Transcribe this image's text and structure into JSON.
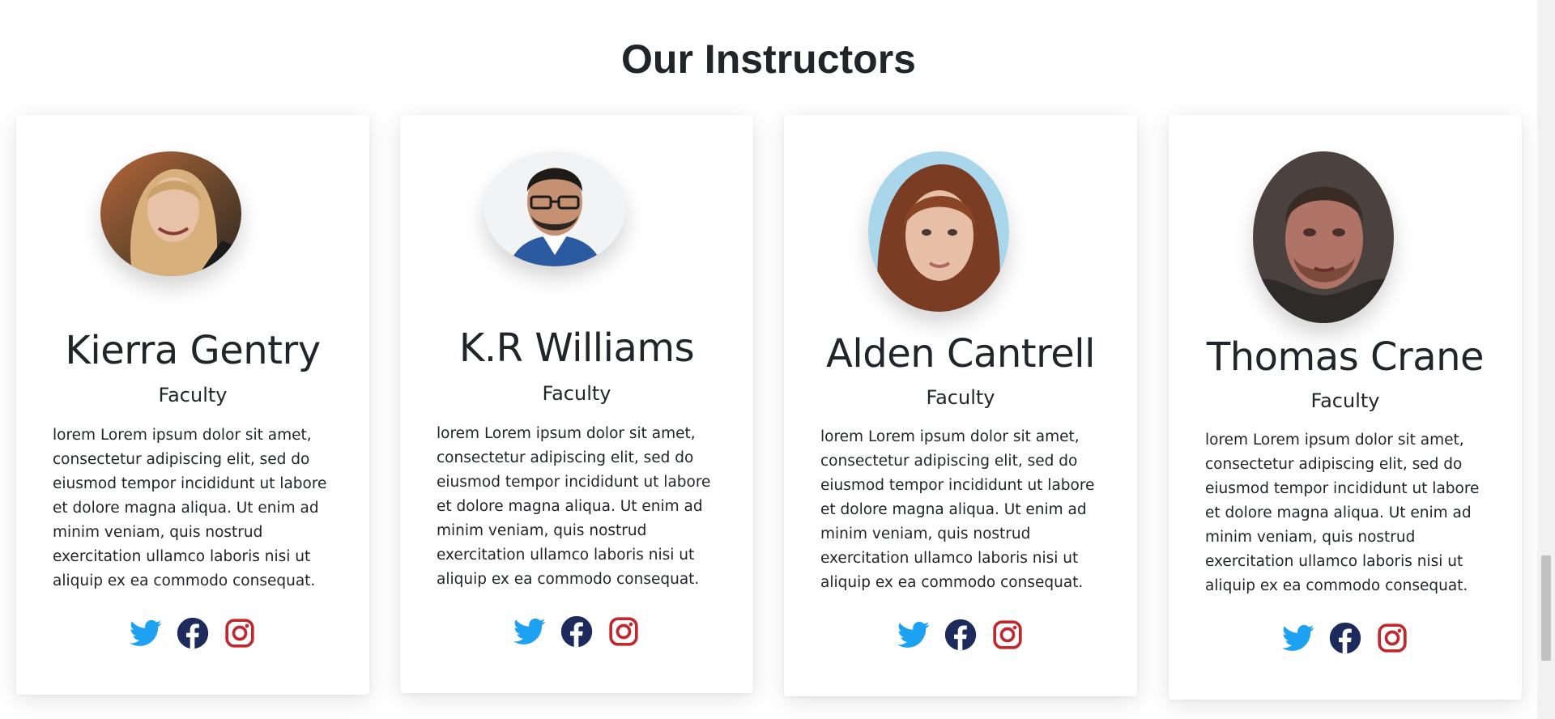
{
  "section": {
    "title": "Our Instructors"
  },
  "instructors": [
    {
      "name": "Kierra Gentry",
      "role": "Faculty",
      "bio": "lorem Lorem ipsum dolor sit amet, consectetur adipiscing elit, sed do eiusmod tempor incididunt ut labore et dolore magna aliqua. Ut enim ad minim veniam, quis nostrud exercitation ullamco laboris nisi ut aliquip ex ea commodo consequat.",
      "socials": [
        "twitter-icon",
        "facebook-icon",
        "instagram-icon"
      ]
    },
    {
      "name": "K.R Williams",
      "role": "Faculty",
      "bio": "lorem Lorem ipsum dolor sit amet, consectetur adipiscing elit, sed do eiusmod tempor incididunt ut labore et dolore magna aliqua. Ut enim ad minim veniam, quis nostrud exercitation ullamco laboris nisi ut aliquip ex ea commodo consequat.",
      "socials": [
        "twitter-icon",
        "facebook-icon",
        "instagram-icon"
      ]
    },
    {
      "name": "Alden Cantrell",
      "role": "Faculty",
      "bio": "lorem Lorem ipsum dolor sit amet, consectetur adipiscing elit, sed do eiusmod tempor incididunt ut labore et dolore magna aliqua. Ut enim ad minim veniam, quis nostrud exercitation ullamco laboris nisi ut aliquip ex ea commodo consequat.",
      "socials": [
        "twitter-icon",
        "facebook-icon",
        "instagram-icon"
      ]
    },
    {
      "name": "Thomas Crane",
      "role": "Faculty",
      "bio": "lorem Lorem ipsum dolor sit amet, consectetur adipiscing elit, sed do eiusmod tempor incididunt ut labore et dolore magna aliqua. Ut enim ad minim veniam, quis nostrud exercitation ullamco laboris nisi ut aliquip ex ea commodo consequat.",
      "socials": [
        "twitter-icon",
        "facebook-icon",
        "instagram-icon"
      ]
    }
  ],
  "colors": {
    "twitter": "#1da1f2",
    "facebook": "#1c2a5c",
    "instagram": "#c1272d",
    "text": "#212529"
  }
}
